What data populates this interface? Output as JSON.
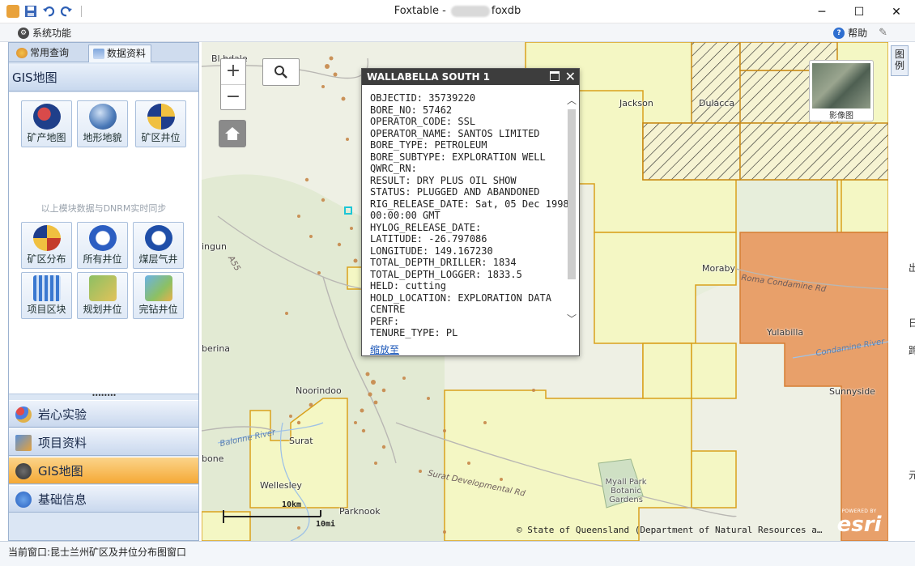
{
  "window": {
    "title_prefix": "Foxtable - ",
    "title_suffix": "foxdb",
    "minimize": "─",
    "maximize": "☐",
    "close": "✕"
  },
  "menu": {
    "system": "系统功能",
    "help": "帮助"
  },
  "left_panel": {
    "tabs": [
      {
        "label": "常用查询"
      },
      {
        "label": "数据资料"
      }
    ],
    "section_title": "GIS地图",
    "tools_row1": [
      {
        "label": "矿产地图",
        "icon": "australia-flag-globe-icon"
      },
      {
        "label": "地形地貌",
        "icon": "globe-icon"
      },
      {
        "label": "矿区井位",
        "icon": "well-map-icon"
      }
    ],
    "sync_note": "以上模块数据与DNRM实时同步",
    "tools_row2": [
      {
        "label": "矿区分布",
        "icon": "well-map-icon"
      },
      {
        "label": "所有井位",
        "icon": "all-badge-icon"
      },
      {
        "label": "煤层气井",
        "icon": "csg-badge-icon"
      }
    ],
    "tools_row3": [
      {
        "label": "项目区块",
        "icon": "grid-calendar-icon"
      },
      {
        "label": "规划井位",
        "icon": "planned-well-icon"
      },
      {
        "label": "完钻井位",
        "icon": "map-pin-icon"
      }
    ],
    "splitter_grip": "••••••••",
    "nav": [
      {
        "label": "岩心实验",
        "icon": "molecule-icon",
        "active": false
      },
      {
        "label": "项目资料",
        "icon": "edit-doc-icon",
        "active": false
      },
      {
        "label": "GIS地图",
        "icon": "gis-icon",
        "active": true
      },
      {
        "label": "基础信息",
        "icon": "info-icon",
        "active": false
      }
    ]
  },
  "map": {
    "place_labels": [
      {
        "text": "Bl  hdale"
      },
      {
        "text": "Jackson"
      },
      {
        "text": "Dulacca"
      },
      {
        "text": "Moraby"
      },
      {
        "text": "Yulabilla"
      },
      {
        "text": "Sunnyside"
      },
      {
        "text": "Noorindoo"
      },
      {
        "text": "Surat"
      },
      {
        "text": "Wellesley"
      },
      {
        "text": "Parknook"
      },
      {
        "text": "ingun"
      },
      {
        "text": "berina"
      },
      {
        "text": "bone"
      },
      {
        "text": "Myall Park Botanic Gardens"
      }
    ],
    "road_labels": [
      {
        "text": "A55"
      },
      {
        "text": "Roma Condamine Rd"
      },
      {
        "text": "Surat Developmental Rd"
      }
    ],
    "river_labels": [
      {
        "text": "Balonne River"
      },
      {
        "text": "Condamine River"
      }
    ],
    "zoom_in": "+",
    "zoom_out": "−",
    "basemap_toggle": "影像图",
    "legend_tab": "图例",
    "scale_km": "10km",
    "scale_mi": "10mi",
    "attribution": "© State of Queensland (Department of Natural Resources a…",
    "esri_powered": "POWERED BY",
    "esri_logo": "esri"
  },
  "popup": {
    "title": "WALLABELLA SOUTH 1",
    "fields": [
      "OBJECTID: 35739220",
      "BORE_NO: 57462",
      "OPERATOR_CODE: SSL",
      "OPERATOR_NAME: SANTOS LIMITED",
      "BORE_TYPE: PETROLEUM",
      "BORE_SUBTYPE: EXPLORATION WELL",
      "QWRC_RN:",
      "RESULT: DRY PLUS OIL SHOW",
      "STATUS: PLUGGED AND ABANDONED",
      "RIG_RELEASE_DATE: Sat, 05 Dec 1998 00:00:00 GMT",
      "HYLOG_RELEASE_DATE:",
      "LATITUDE: -26.797086",
      "LONGITUDE: 149.167230",
      "TOTAL_DEPTH_DRILLER: 1834",
      "TOTAL_DEPTH_LOGGER: 1833.5",
      "HELD: cutting",
      "HOLD_LOCATION: EXPLORATION DATA CENTRE",
      "PERF:",
      "TENURE_TYPE: PL"
    ],
    "zoom_to": "缩放至"
  },
  "status": {
    "current_window": "当前窗口:昆士兰州矿区及井位分布图窗口"
  },
  "right_edge_glyphs": [
    "出",
    "日",
    "蹄",
    "元"
  ],
  "colors": {
    "tenement_fill": "#f4f7c4",
    "tenement_border": "#d9a11c",
    "orange_area": "#e8a06a",
    "hatched_border": "#c98b17",
    "well_dot": "#c7884a",
    "nav_active": "#f5a936",
    "panel_bg": "#dbe6f4"
  }
}
